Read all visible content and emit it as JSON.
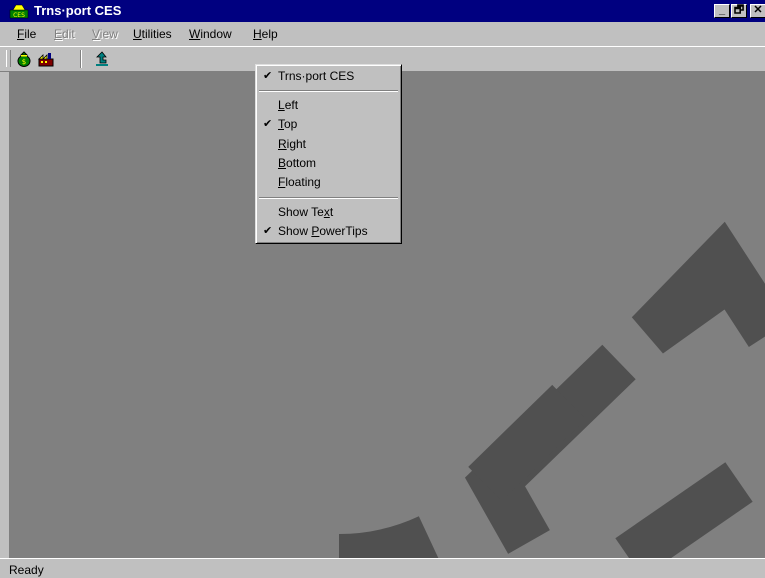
{
  "window": {
    "title": "Trns·port CES",
    "app_icon": "ces-app-icon",
    "buttons": [
      "_",
      "🗗",
      "✕"
    ]
  },
  "menubar": {
    "items": [
      {
        "label": "File",
        "key": "F",
        "rest": "ile",
        "enabled": true
      },
      {
        "label": "Edit",
        "key": "E",
        "rest": "dit",
        "enabled": false
      },
      {
        "label": "View",
        "key": "V",
        "rest": "iew",
        "enabled": false
      },
      {
        "label": "Utilities",
        "key": "U",
        "rest": "tilities",
        "enabled": true
      },
      {
        "label": "Window",
        "key": "W",
        "rest": "indow",
        "enabled": true
      },
      {
        "label": "Help",
        "key": "H",
        "rest": "elp",
        "enabled": true
      }
    ]
  },
  "toolbar": {
    "icons": [
      "money-bag-icon",
      "factory-icon",
      "exit-arrow-icon"
    ]
  },
  "context_menu": {
    "items": [
      {
        "label": "Trns·port CES",
        "checked": true
      },
      {
        "pre": "",
        "key": "L",
        "post": "eft",
        "checked": false
      },
      {
        "pre": "",
        "key": "T",
        "post": "op",
        "checked": true
      },
      {
        "pre": "",
        "key": "R",
        "post": "ight",
        "checked": false
      },
      {
        "pre": "",
        "key": "B",
        "post": "ottom",
        "checked": false
      },
      {
        "pre": "",
        "key": "F",
        "post": "loating",
        "checked": false
      },
      {
        "pre": "Show Te",
        "key": "x",
        "post": "t",
        "checked": false
      },
      {
        "pre": "Show ",
        "key": "P",
        "post": "owerTips",
        "checked": true
      }
    ],
    "check_glyph": "✔"
  },
  "watermark": {
    "text": "CED",
    "color": "#505050"
  },
  "statusbar": {
    "text": "Ready"
  },
  "colors": {
    "titlebar": "#000080",
    "face": "#c0c0c0",
    "workspace": "#808080"
  }
}
